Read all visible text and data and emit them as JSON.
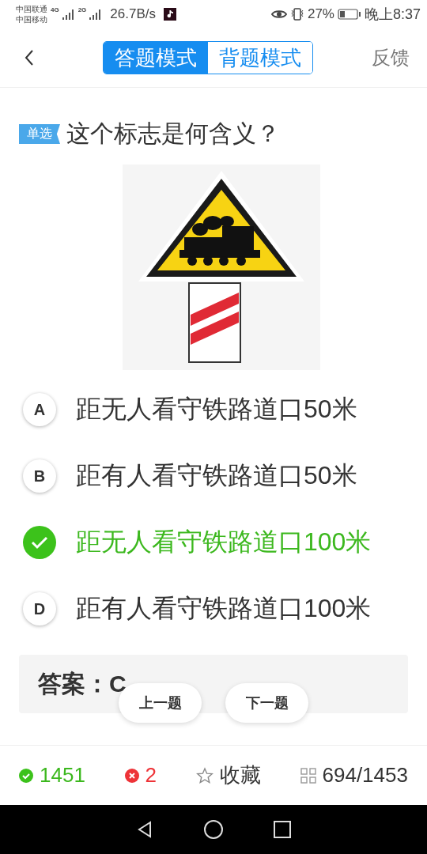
{
  "status_bar": {
    "carriers": [
      "中国联通",
      "中国移动"
    ],
    "network_1": "4G",
    "network_2": "2G",
    "speed": "26.7B/s",
    "battery_percent": "27%",
    "time": "晚上8:37"
  },
  "header": {
    "modes": [
      {
        "label": "答题模式",
        "selected": true
      },
      {
        "label": "背题模式",
        "selected": false
      }
    ],
    "feedback": "反馈"
  },
  "question": {
    "type_tag": "单选",
    "text": "这个标志是何含义？"
  },
  "options": [
    {
      "letter": "A",
      "text": "距无人看守铁路道口50米",
      "selected": false
    },
    {
      "letter": "B",
      "text": "距有人看守铁路道口50米",
      "selected": false
    },
    {
      "text": "距无人看守铁路道口100米",
      "selected": true
    },
    {
      "letter": "D",
      "text": "距有人看守铁路道口100米",
      "selected": false
    }
  ],
  "answer": "答案：C",
  "nav_buttons": [
    "上一题",
    "下一题"
  ],
  "bottom_bar": {
    "correct": "1451",
    "wrong": "2",
    "favorite": "收藏",
    "progress": "694/1453"
  }
}
